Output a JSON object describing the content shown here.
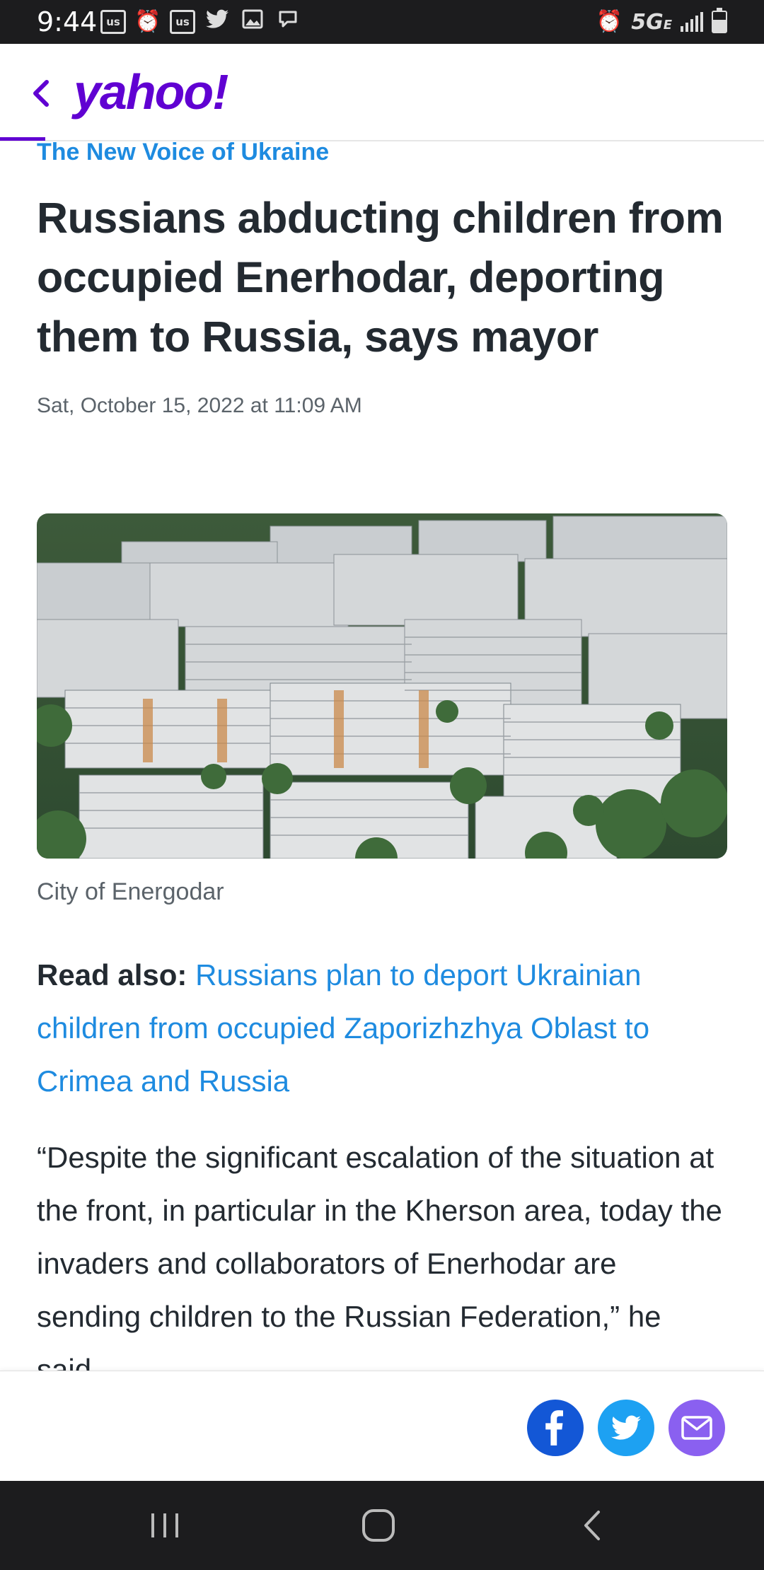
{
  "status_bar": {
    "time": "9:44",
    "left_icons": [
      "us-news-icon",
      "alarm-icon",
      "us-news-icon",
      "twitter-icon",
      "gallery-icon",
      "chat-icon"
    ],
    "left_box_text": "us",
    "network": "5G",
    "network_sub": "E",
    "battery_level": 0.6
  },
  "header": {
    "logo": "yahoo!",
    "brand_color": "#6001d2"
  },
  "article": {
    "provider": "The New Voice of Ukraine",
    "headline": "Russians abducting children from occupied Enerhodar, deporting them to Russia, says mayor",
    "timestamp": "Sat, October 15, 2022 at 11:09 AM",
    "image_caption": "City of Energodar",
    "read_also_label": "Read also:",
    "read_also_link": "Russians plan to deport Ukrainian children from occupied Zaporizhzhya Oblast to Crimea and Russia",
    "quote": "“Despite the significant escalation of the situation at the front, in particular in the Kherson area, today the invaders and collaborators of Enerhodar are sending children to the Russian Federation,” he said."
  },
  "share": {
    "buttons": [
      "facebook-icon",
      "twitter-icon",
      "mail-icon"
    ]
  },
  "colors": {
    "link": "#1e8be0",
    "text": "#232a31",
    "meta": "#5b636a",
    "facebook": "#1357d6",
    "twitter": "#1da1f2",
    "mail": "#8a60f0"
  }
}
